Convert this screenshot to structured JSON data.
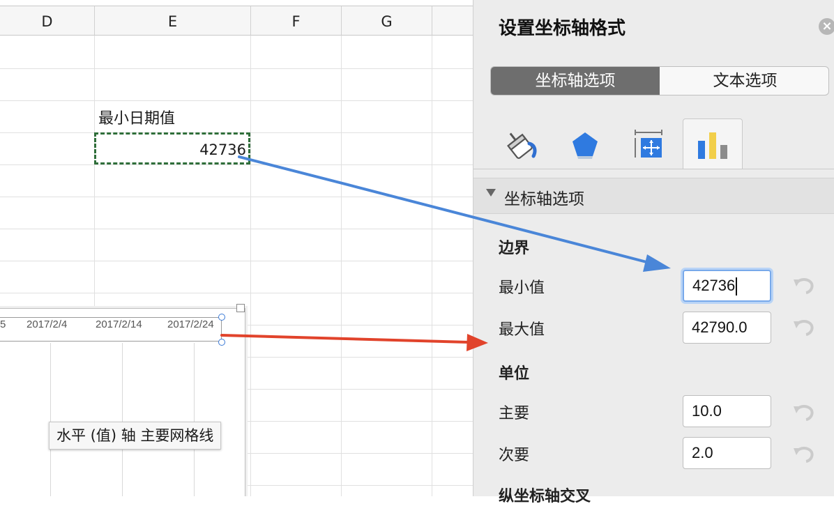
{
  "sheet": {
    "columns": [
      "D",
      "E",
      "F",
      "G"
    ],
    "cell_label": "最小日期值",
    "cell_value": "42736",
    "chart_ticks": [
      "5",
      "2017/2/4",
      "2017/2/14",
      "2017/2/24"
    ],
    "tooltip": "水平 (值) 轴 主要网格线"
  },
  "panel": {
    "title": "设置坐标轴格式",
    "close_glyph": "×",
    "seg_tabs": [
      "坐标轴选项",
      "文本选项"
    ],
    "icon_tabs": [
      "paint-bucket-icon",
      "pentagon-icon",
      "size-properties-icon",
      "bar-chart-icon"
    ],
    "section_title": "坐标轴选项",
    "bounds_heading": "边界",
    "min_label": "最小值",
    "min_value": "42736",
    "max_label": "最大值",
    "max_value": "42790.0",
    "units_heading": "单位",
    "major_label": "主要",
    "major_value": "10.0",
    "minor_label": "次要",
    "minor_value": "2.0",
    "cross_heading": "纵坐标轴交叉"
  },
  "colors": {
    "arrow_blue": "#4a86d8",
    "arrow_red": "#e1432b",
    "selected_cell_border": "#2f6e3a",
    "active_segment": "#6e6e6e"
  }
}
